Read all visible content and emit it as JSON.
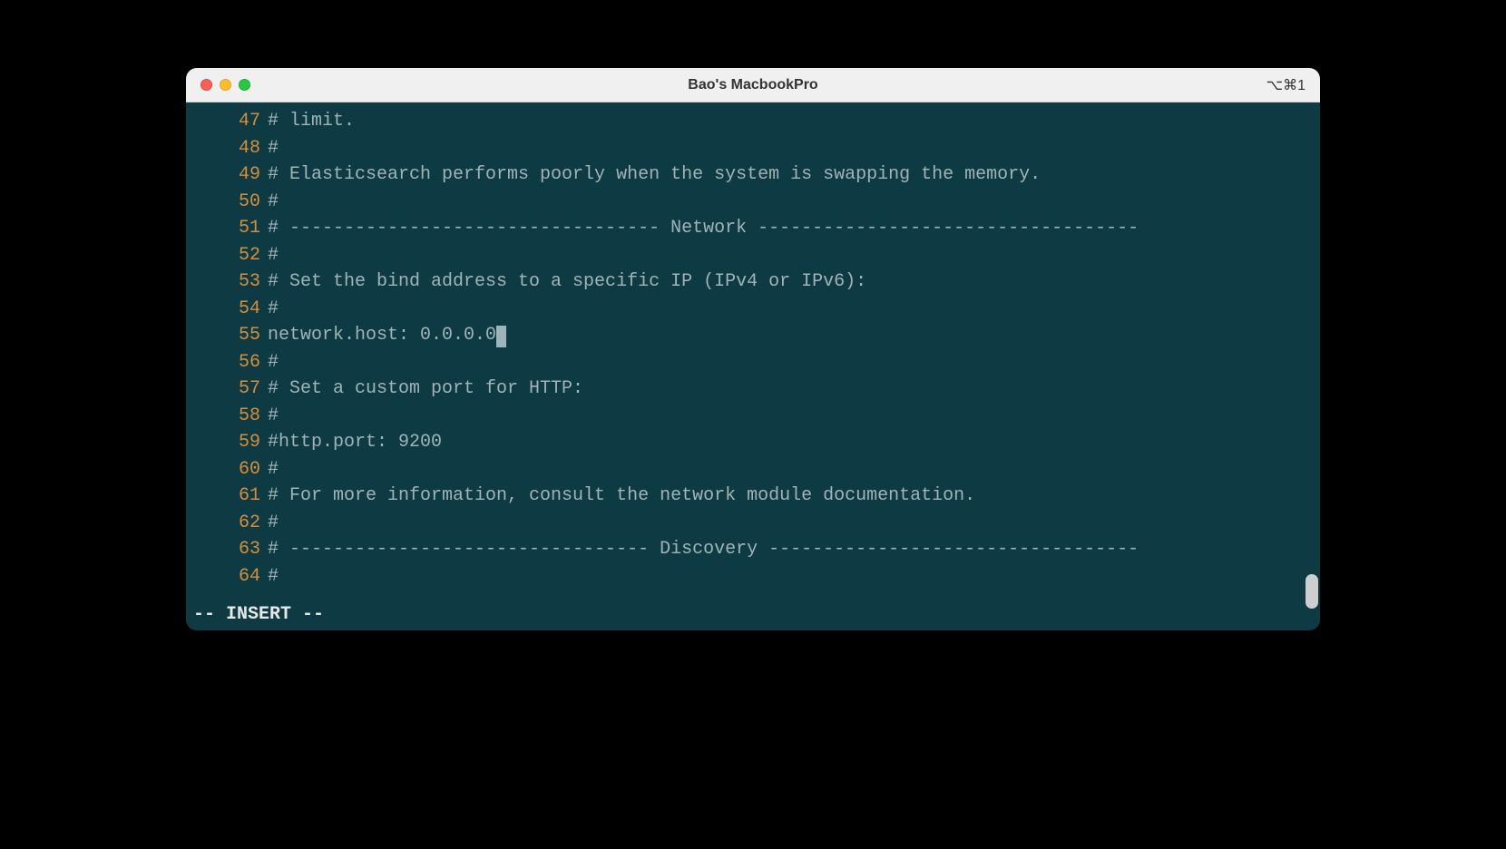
{
  "window": {
    "title": "Bao's MacbookPro",
    "shortcut": "⌥⌘1"
  },
  "editor": {
    "cursorLine": 55,
    "lines": [
      {
        "no": 47,
        "text": "# limit."
      },
      {
        "no": 48,
        "text": "#"
      },
      {
        "no": 49,
        "text": "# Elasticsearch performs poorly when the system is swapping the memory."
      },
      {
        "no": 50,
        "text": "#"
      },
      {
        "no": 51,
        "text": "# ---------------------------------- Network -----------------------------------"
      },
      {
        "no": 52,
        "text": "#"
      },
      {
        "no": 53,
        "text": "# Set the bind address to a specific IP (IPv4 or IPv6):"
      },
      {
        "no": 54,
        "text": "#"
      },
      {
        "no": 55,
        "text": "network.host: 0.0.0.0"
      },
      {
        "no": 56,
        "text": "#"
      },
      {
        "no": 57,
        "text": "# Set a custom port for HTTP:"
      },
      {
        "no": 58,
        "text": "#"
      },
      {
        "no": 59,
        "text": "#http.port: 9200"
      },
      {
        "no": 60,
        "text": "#"
      },
      {
        "no": 61,
        "text": "# For more information, consult the network module documentation."
      },
      {
        "no": 62,
        "text": "#"
      },
      {
        "no": 63,
        "text": "# --------------------------------- Discovery ----------------------------------"
      },
      {
        "no": 64,
        "text": "#"
      }
    ],
    "status": "-- INSERT --"
  }
}
